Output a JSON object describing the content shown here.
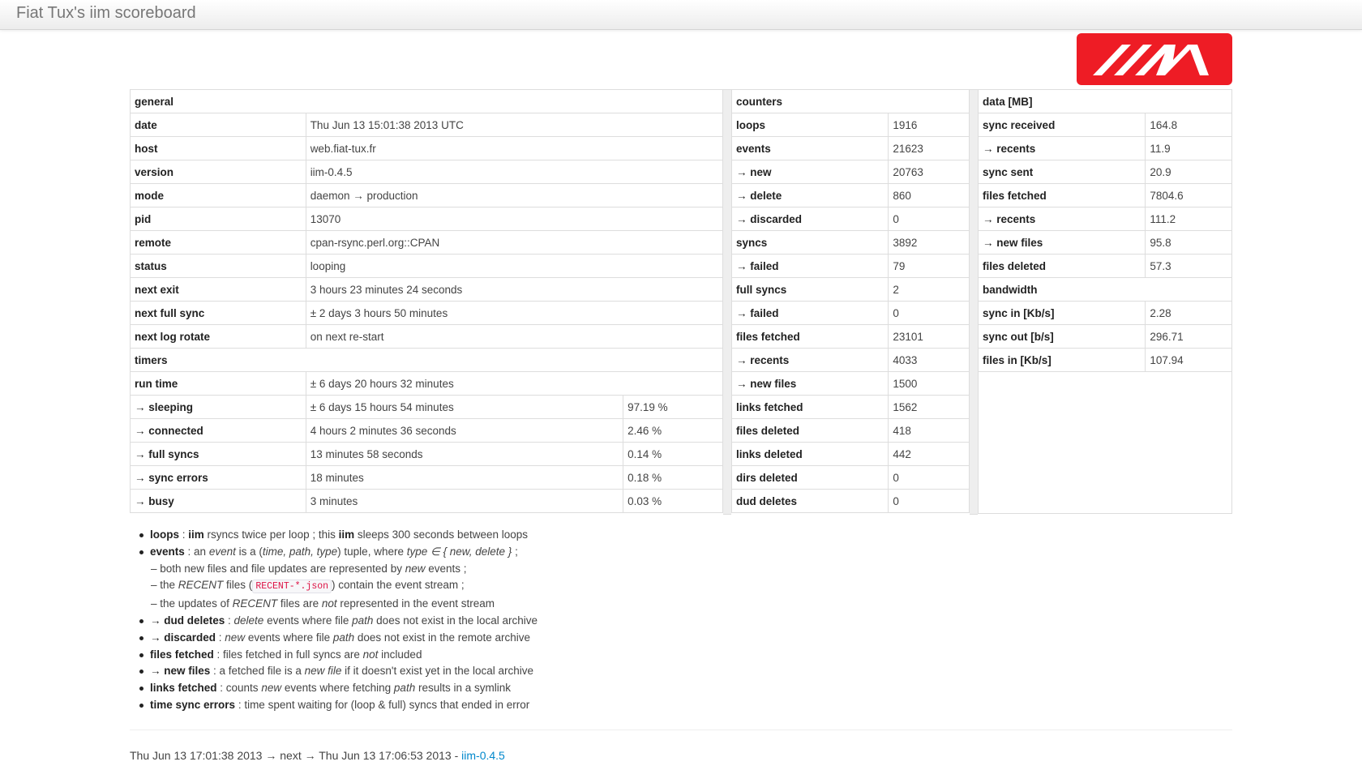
{
  "app": {
    "title": "Fiat Tux's iim scoreboard"
  },
  "general": {
    "header": "general",
    "rows": [
      {
        "key": "date",
        "value": "Thu Jun 13 15:01:38 2013 UTC"
      },
      {
        "key": "host",
        "value": "web.fiat-tux.fr"
      },
      {
        "key": "version",
        "value": "iim-0.4.5"
      },
      {
        "key": "mode",
        "value": "daemon → production"
      },
      {
        "key": "pid",
        "value": "13070"
      },
      {
        "key": "remote",
        "value": "cpan-rsync.perl.org::CPAN"
      },
      {
        "key": "status",
        "value": "looping"
      },
      {
        "key": "next exit",
        "value": "3 hours 23 minutes 24 seconds"
      },
      {
        "key": "next full sync",
        "value": "± 2 days 3 hours 50 minutes"
      },
      {
        "key": "next log rotate",
        "value": "on next re-start"
      }
    ]
  },
  "timers": {
    "header": "timers",
    "run_time": {
      "key": "run time",
      "value": "± 6 days 20 hours 32 minutes"
    },
    "rows": [
      {
        "key": "→ sleeping",
        "value": "± 6 days 15 hours 54 minutes",
        "pct": "97.19 %"
      },
      {
        "key": "→ connected",
        "value": "4 hours 2 minutes 36 seconds",
        "pct": "2.46 %"
      },
      {
        "key": "→ full syncs",
        "value": "13 minutes 58 seconds",
        "pct": "0.14 %"
      },
      {
        "key": "→ sync errors",
        "value": "18 minutes",
        "pct": "0.18 %"
      },
      {
        "key": "→ busy",
        "value": "3 minutes",
        "pct": "0.03 %"
      }
    ]
  },
  "counters": {
    "header": "counters",
    "rows": [
      {
        "key": "loops",
        "value": "1916"
      },
      {
        "key": "events",
        "value": "21623"
      },
      {
        "key": "→ new",
        "value": "20763"
      },
      {
        "key": "→ delete",
        "value": "860"
      },
      {
        "key": "→ discarded",
        "value": "0"
      },
      {
        "key": "syncs",
        "value": "3892"
      },
      {
        "key": "→ failed",
        "value": "79"
      },
      {
        "key": "full syncs",
        "value": "2"
      },
      {
        "key": "→ failed",
        "value": "0"
      },
      {
        "key": "files fetched",
        "value": "23101"
      },
      {
        "key": "→ recents",
        "value": "4033"
      },
      {
        "key": "→ new files",
        "value": "1500"
      },
      {
        "key": "links fetched",
        "value": "1562"
      },
      {
        "key": "files deleted",
        "value": "418"
      },
      {
        "key": "links deleted",
        "value": "442"
      },
      {
        "key": "dirs deleted",
        "value": "0"
      },
      {
        "key": "dud deletes",
        "value": "0"
      }
    ]
  },
  "data_mb": {
    "header": "data [MB]",
    "rows": [
      {
        "key": "sync received",
        "value": "164.8"
      },
      {
        "key": "→ recents",
        "value": "11.9"
      },
      {
        "key": "sync sent",
        "value": "20.9"
      },
      {
        "key": "files fetched",
        "value": "7804.6"
      },
      {
        "key": "→ recents",
        "value": "111.2"
      },
      {
        "key": "→ new files",
        "value": "95.8"
      },
      {
        "key": "files deleted",
        "value": "57.3"
      }
    ]
  },
  "bandwidth": {
    "header": "bandwidth",
    "rows": [
      {
        "key": "sync in [Kb/s]",
        "value": "2.28"
      },
      {
        "key": "sync out [b/s]",
        "value": "296.71"
      },
      {
        "key": "files in [Kb/s]",
        "value": "107.94"
      }
    ]
  },
  "notes": {
    "loops": {
      "term": "loops",
      "t1": " : ",
      "b1": "iim",
      "t2": " rsyncs twice per loop ; this ",
      "b2": "iim",
      "t3": " sleeps 300 seconds between loops"
    },
    "events": {
      "term": "events",
      "t1": " : an ",
      "i1": "event",
      "t2": " is a (",
      "i2": "time, path, type",
      "t3": ") tuple, where ",
      "i3": "type ∈ { new, delete }",
      "t4": " ;"
    },
    "events_sub1": {
      "t1": "– both new files and file updates are represented by ",
      "i1": "new",
      "t2": " events ;"
    },
    "events_sub2": {
      "t1": "– the ",
      "i1": "RECENT",
      "t2": " files (",
      "code": "RECENT-*.json",
      "t3": ") contain the event stream ;"
    },
    "events_sub3": {
      "t1": "– the updates of ",
      "i1": "RECENT",
      "t2": " files are ",
      "i2": "not",
      "t3": " represented in the event stream"
    },
    "dud": {
      "term": "→ dud deletes",
      "t1": " : ",
      "i1": "delete",
      "t2": " events where file ",
      "i2": "path",
      "t3": " does not exist in the local archive"
    },
    "discarded": {
      "term": "→ discarded",
      "t1": " : ",
      "i1": "new",
      "t2": " events where file ",
      "i2": "path",
      "t3": " does not exist in the remote archive"
    },
    "files_fetched": {
      "term": "files fetched",
      "t1": " : files fetched in full syncs are ",
      "i1": "not",
      "t2": " included"
    },
    "new_files": {
      "term": "→ new files",
      "t1": " : a fetched file is a ",
      "i1": "new file",
      "t2": " if it doesn't exist yet in the local archive"
    },
    "links_fetched": {
      "term": "links fetched",
      "t1": " : counts ",
      "i1": "new",
      "t2": " events where fetching ",
      "i2": "path",
      "t3": " results in a symlink"
    },
    "sync_errors": {
      "term": "time sync errors",
      "t1": " : time spent waiting for (loop & full) syncs that ended in error"
    }
  },
  "footer": {
    "text": "Thu Jun 13 17:01:38 2013 → next → Thu Jun 13 17:06:53 2013 - ",
    "link": "iim-0.4.5"
  }
}
